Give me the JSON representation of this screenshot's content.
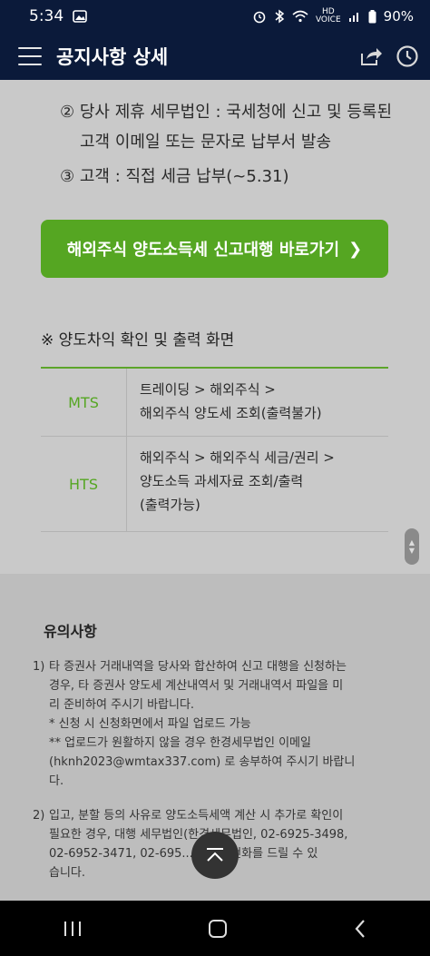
{
  "status_bar": {
    "time": "5:34",
    "hd_label": "HD",
    "voice_label": "VOICE",
    "battery": "90%"
  },
  "app_bar": {
    "title": "공지사항 상세"
  },
  "content": {
    "list_items": [
      "② 당사 제휴 세무법인 : 국세청에 신고 및 등록된",
      "고객 이메일 또는 문자로 납부서 발송",
      "③ 고객 : 직접 세금 납부(~5.31)"
    ],
    "cta_label": "해외주식 양도소득세 신고대행 바로가기",
    "cta_arrow": "❯",
    "section_heading": "※ 양도차익 확인 및 출력 화면",
    "table": [
      {
        "key": "MTS",
        "lines": [
          "트레이딩 > 해외주식 >",
          "해외주식 양도세 조회(출력불가)"
        ]
      },
      {
        "key": "HTS",
        "lines": [
          "해외주식 > 해외주식 세금/권리 >",
          "양도소득 과세자료 조회/출력",
          "(출력가능)"
        ]
      }
    ]
  },
  "notice": {
    "title": "유의사항",
    "items": [
      {
        "num": "1)",
        "lines": [
          "타 증권사 거래내역을 당사와 합산하여 신고 대행을 신청하는",
          "경우, 타 증권사 양도세 계산내역서 및 거래내역서 파일을 미",
          "리 준비하여 주시기 바랍니다.",
          "* 신청 시 신청화면에서 파일 업로드 가능",
          "** 업로드가 원활하지 않을 경우 한경세무법인 이메일",
          "(hknh2023@wmtax337.com) 로 송부하여 주시기 바랍니",
          "다."
        ]
      },
      {
        "num": "2)",
        "lines": [
          "입고, 분할 등의 사유로 양도소득세액 계산 시 추가로 확인이",
          "필요한 경우, 대행 세무법인(한경세무법인, 02-6925-3498,",
          "02-6952-3471, 02-695...6)에서 전화를 드릴 수 있",
          "습니다."
        ]
      }
    ]
  },
  "icons": {
    "menu": "hamburger-icon",
    "share": "share-icon",
    "clock": "clock-icon",
    "scroll_top": "chevron-up-icon"
  }
}
